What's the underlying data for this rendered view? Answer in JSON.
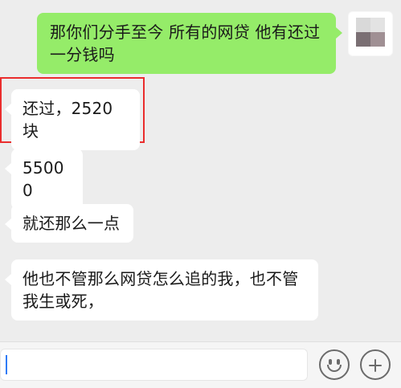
{
  "messages": [
    {
      "side": "right",
      "text": "那你们分手至今 所有的网贷 他有还过一分钱吗"
    },
    {
      "side": "left",
      "text": "还过，2520块"
    },
    {
      "side": "left",
      "text": "55000"
    },
    {
      "side": "left",
      "text": "就还那么一点"
    },
    {
      "side": "left",
      "text": "他也不管那么网贷怎么追的我，也不管我生或死，"
    }
  ],
  "input": {
    "value": ""
  },
  "icons": {
    "emoji": "emoji-icon",
    "add": "plus-icon"
  },
  "colors": {
    "background": "#ededed",
    "sent_bubble": "#95ec69",
    "received_bubble": "#ffffff",
    "highlight": "#ea2d2d",
    "caret": "#2f7bf6"
  }
}
